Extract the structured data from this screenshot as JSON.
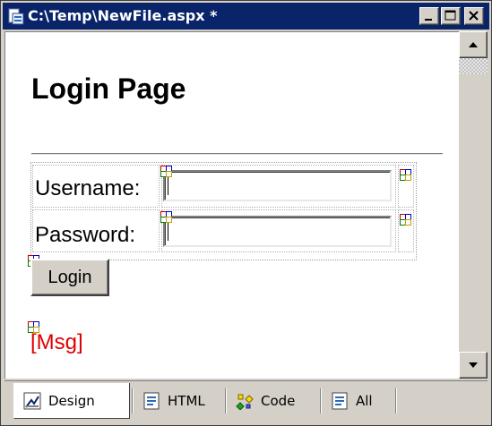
{
  "window": {
    "title": "C:\\Temp\\NewFile.aspx *",
    "icon": "aspx-file-icon",
    "controls": [
      "minimize-icon",
      "maximize-icon",
      "close-icon"
    ]
  },
  "page": {
    "heading": "Login Page",
    "username_label": "Username:",
    "username_value": "",
    "password_label": "Password:",
    "password_value": "",
    "login_button": "Login",
    "message": "[Msg]",
    "message_color": "#e00000",
    "control_glyph": "server-control-glyph-icon"
  },
  "scrollbar": {
    "up_icon": "arrow-up-icon",
    "down_icon": "arrow-down-icon"
  },
  "tabs": [
    {
      "label": "Design",
      "icon": "design-icon",
      "active": true
    },
    {
      "label": "HTML",
      "icon": "html-icon",
      "active": false
    },
    {
      "label": "Code",
      "icon": "code-icon",
      "active": false
    },
    {
      "label": "All",
      "icon": "all-view-icon",
      "active": false
    }
  ],
  "colors": {
    "titlebar": "#0a246a",
    "chrome": "#d4d0c8",
    "surface": "#ffffff"
  }
}
